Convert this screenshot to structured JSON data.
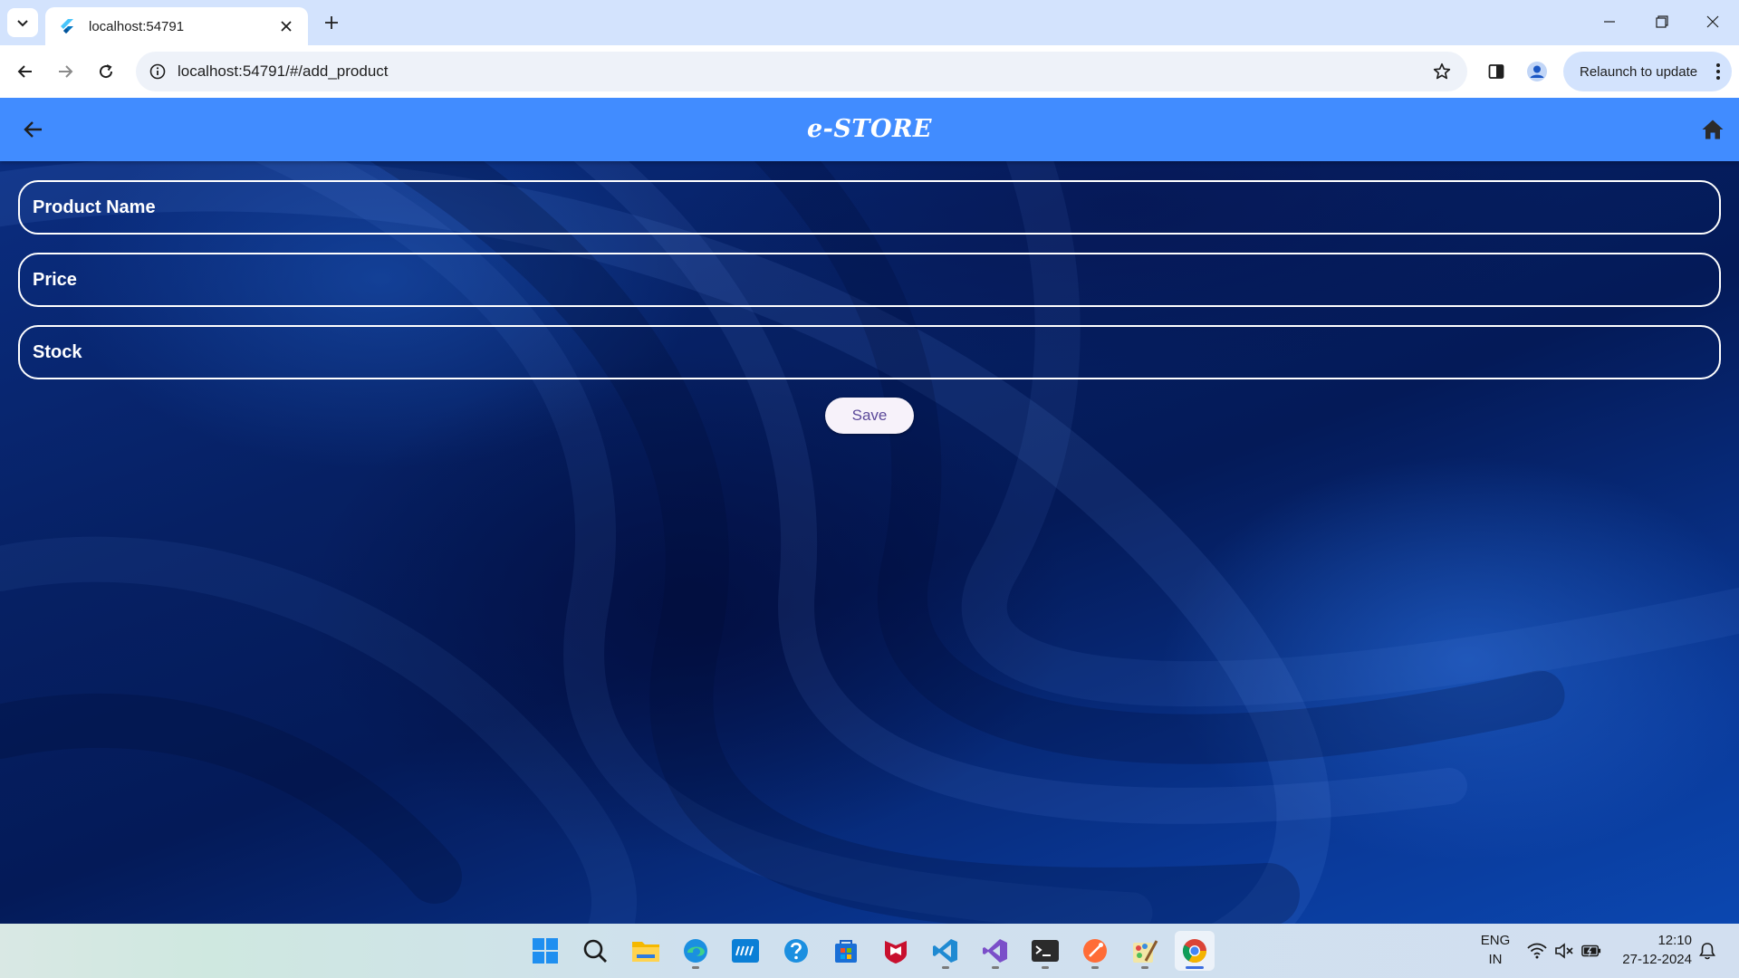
{
  "browser": {
    "tab_title": "localhost:54791",
    "url": "localhost:54791/#/add_product",
    "relaunch_label": "Relaunch to update"
  },
  "app": {
    "title": "e-STORE",
    "fields": [
      {
        "label": "Product Name"
      },
      {
        "label": "Price"
      },
      {
        "label": "Stock"
      }
    ],
    "save_label": "Save",
    "appbar_color": "#418cff"
  },
  "taskbar": {
    "apps": [
      "windows-start",
      "search",
      "file-explorer",
      "edge",
      "myhp",
      "get-help",
      "microsoft-store",
      "mcafee",
      "vscode",
      "visual-studio",
      "terminal",
      "postman",
      "paint",
      "chrome"
    ],
    "language": "ENG",
    "region": "IN",
    "time": "12:10",
    "date": "27-12-2024"
  }
}
